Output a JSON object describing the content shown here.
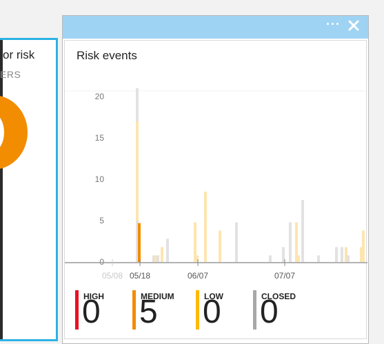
{
  "left_tile": {
    "title": "or risk",
    "subtitle": "ERS"
  },
  "blade": {
    "ellipsis": "···",
    "card_title": "Risk events"
  },
  "colors": {
    "high": "#e81123",
    "medium": "#f28c00",
    "medium_light": "#fbd6a8",
    "low": "#ffb900",
    "low_light": "#fde5b0",
    "closed": "#a8a8a8",
    "closed_light": "#e2e2e2",
    "header": "#9fd3f3",
    "tile_border": "#2cb2e4"
  },
  "chart_data": {
    "type": "bar",
    "ylim": [
      0,
      21
    ],
    "yticks": [
      "0",
      "5",
      "10",
      "15",
      "20"
    ],
    "xtick_labels": [
      {
        "label": "05/08",
        "faded": true
      },
      {
        "label": "05/18",
        "faded": false
      },
      {
        "label": "06/07",
        "faded": false
      },
      {
        "label": "07/07",
        "faded": false
      }
    ],
    "bars": [
      {
        "series": "closed_light",
        "value": 21
      },
      {
        "series": "low_light",
        "value": 17
      },
      {
        "series": "closed_light",
        "value": 5
      },
      {
        "series": "medium",
        "value": 4.7
      },
      {
        "series": "closed_light",
        "value": 0.8
      },
      {
        "series": "low_light",
        "value": 0.8
      },
      {
        "series": "closed_light",
        "value": 0.8
      },
      {
        "series": "low_light",
        "value": 1.8
      },
      {
        "series": "closed_light",
        "value": 2.8
      },
      {
        "series": "low_light",
        "value": 4.8
      },
      {
        "series": "low_light",
        "value": 0.8
      },
      {
        "series": "low_light",
        "value": 8.5
      },
      {
        "series": "low_light",
        "value": 3.8
      },
      {
        "series": "closed_light",
        "value": 4.8
      },
      {
        "series": "closed_light",
        "value": 0.8
      },
      {
        "series": "closed_light",
        "value": 1.8
      },
      {
        "series": "closed_light",
        "value": 4.8
      },
      {
        "series": "low_light",
        "value": 4.8
      },
      {
        "series": "low_light",
        "value": 0.8
      },
      {
        "series": "closed_light",
        "value": 7.5
      },
      {
        "series": "closed_light",
        "value": 0.8
      },
      {
        "series": "closed_light",
        "value": 1.8
      },
      {
        "series": "closed_light",
        "value": 1.8
      },
      {
        "series": "low_light",
        "value": 1.8
      },
      {
        "series": "closed_light",
        "value": 0.8
      },
      {
        "series": "low_light",
        "value": 1.8
      },
      {
        "series": "low_light",
        "value": 3.8
      }
    ]
  },
  "legend": [
    {
      "label": "HIGH",
      "value": "0",
      "color": "#e81123"
    },
    {
      "label": "MEDIUM",
      "value": "5",
      "color": "#f28c00"
    },
    {
      "label": "LOW",
      "value": "0",
      "color": "#ffb900"
    },
    {
      "label": "CLOSED",
      "value": "0",
      "color": "#a8a8a8"
    }
  ]
}
